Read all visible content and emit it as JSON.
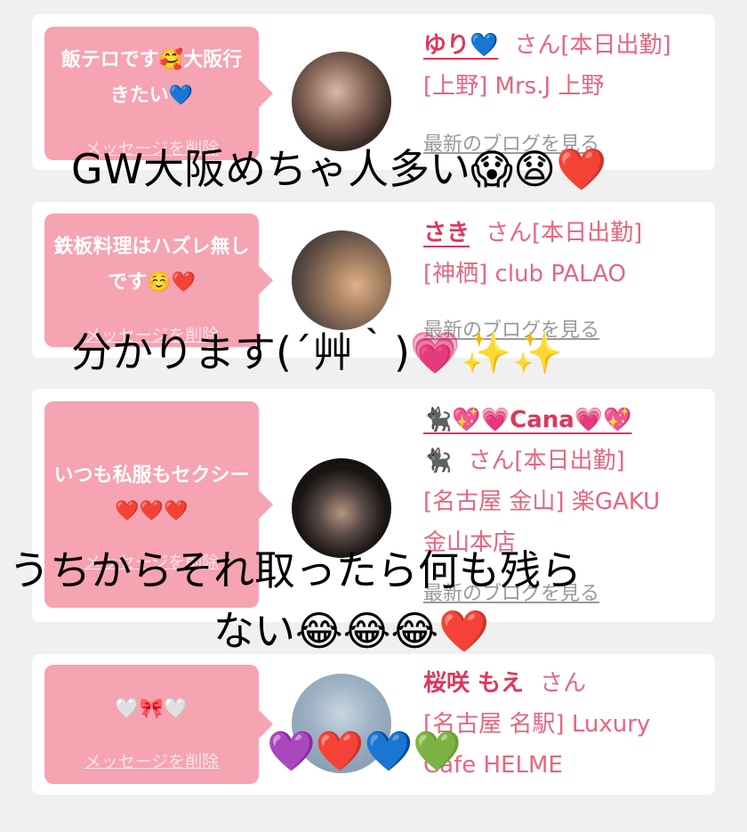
{
  "cards": [
    {
      "message": "飯テロです🥰大阪行きたい💙",
      "delete_label": "メッセージを削除",
      "name": "ゆり💙",
      "san_status": "さん[本日出勤]",
      "location": "[上野] Mrs.J 上野",
      "blog_label": "最新のブログを見る"
    },
    {
      "message": "鉄板料理はハズレ無しです☺️❤️",
      "delete_label": "メッセージを削除",
      "name": "さき",
      "san_status": "さん[本日出勤]",
      "location": "[神栖] club PALAO",
      "blog_label": "最新のブログを見る"
    },
    {
      "message": "いつも私服もセクシー❤️❤️❤️",
      "delete_label": "メッセージを削除",
      "name": "🐈‍⬛💖💗Cana💗💖",
      "name_line2": "🐈‍⬛",
      "san_status": "さん[本日出勤]",
      "location": "[名古屋 金山] 楽GAKU",
      "location_line2": "金山本店",
      "blog_label": "最新のブログを見る"
    },
    {
      "message": "🤍🎀🤍",
      "delete_label": "メッセージを削除",
      "name": "桜咲 もえ",
      "san_status": "さん",
      "location": "[名古屋 名駅] Luxury",
      "location_line2": "Cafe HELME"
    }
  ],
  "overlays": [
    "GW大阪めちゃ人多い😱😧❤️",
    "分かります(´艸｀)💗✨✨",
    "うちからそれ取ったら何も残ら",
    "ない😂😂😂❤️",
    "💜❤️💙💚"
  ]
}
